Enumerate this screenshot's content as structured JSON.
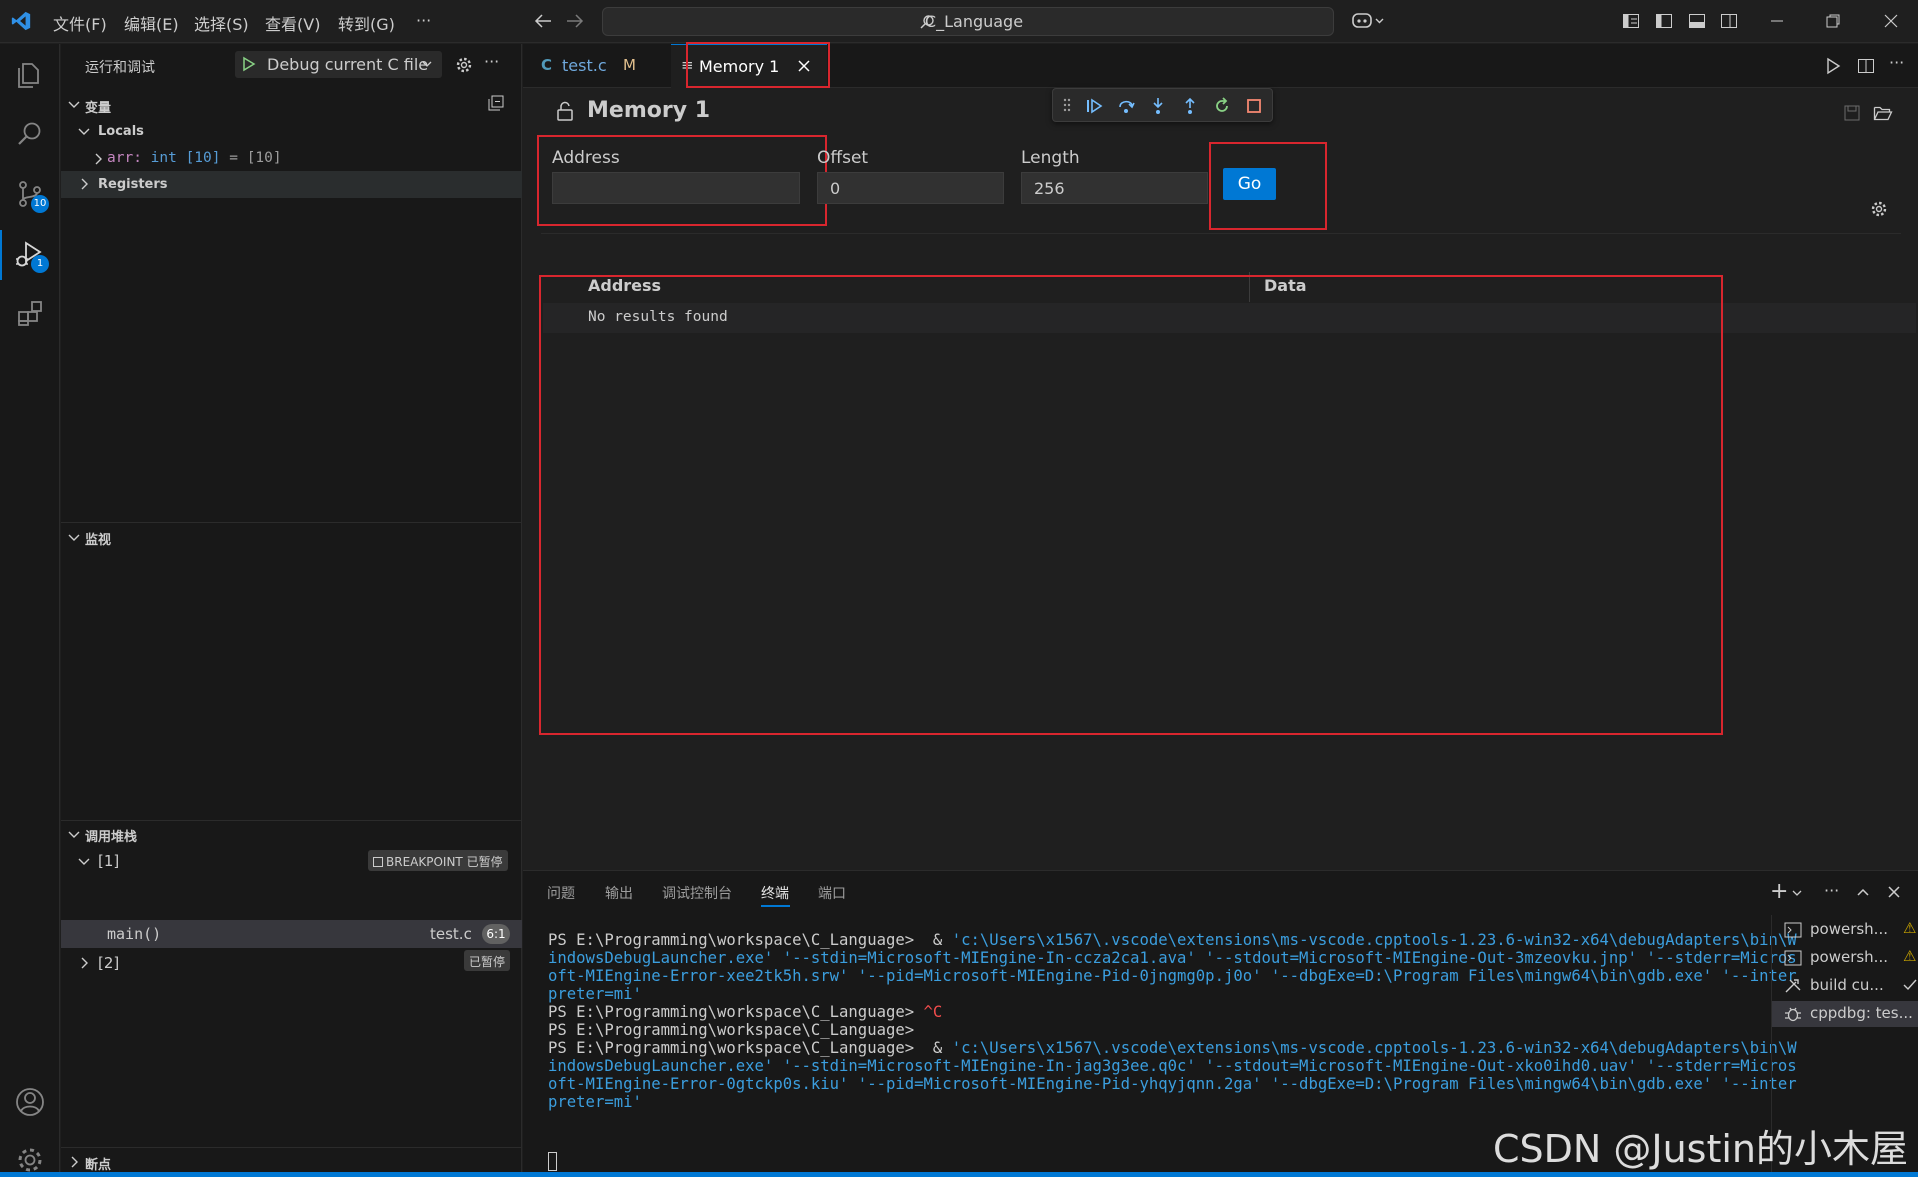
{
  "menu": [
    "文件(F)",
    "编辑(E)",
    "选择(S)",
    "查看(V)",
    "转到(G)",
    "···"
  ],
  "search": {
    "text": "C_Language"
  },
  "activity": {
    "scm_badge": "10",
    "debug_badge": "1"
  },
  "sidebar": {
    "title": "运行和调试",
    "config": "Debug current C file",
    "variables_header": "变量",
    "locals_label": "Locals",
    "arr_name": "arr:",
    "arr_type": "int [10]",
    "arr_eq": "=",
    "arr_value": "[10]",
    "registers_label": "Registers",
    "watch_header": "监视",
    "callstack_header": "调用堆栈",
    "thread1_label": "[1]",
    "thread1_badge": "BREAKPOINT 已暂停",
    "frame_name": "main()",
    "frame_file": "test.c",
    "frame_line": "6:1",
    "thread2_label": "[2]",
    "thread2_badge": "已暂停",
    "breakpoints_header": "断点"
  },
  "tabs": [
    {
      "icon": "C",
      "label": "test.c",
      "badge": "M"
    },
    {
      "icon": "≡",
      "label": "Memory 1"
    }
  ],
  "memory": {
    "title": "Memory 1",
    "address_label": "Address",
    "address_value": "",
    "offset_label": "Offset",
    "offset_value": "0",
    "length_label": "Length",
    "length_value": "256",
    "go_label": "Go",
    "col_address": "Address",
    "col_data": "Data",
    "empty_text": "No results found"
  },
  "panel": {
    "tabs": [
      "问题",
      "输出",
      "调试控制台",
      "终端",
      "端口"
    ],
    "active_tab": "终端",
    "terminals": [
      {
        "label": "powersh...",
        "status": "warning"
      },
      {
        "label": "powersh...",
        "status": "warning"
      },
      {
        "label": "build cu...",
        "status": "check"
      },
      {
        "label": "cppdbg: tes...",
        "status": "active"
      }
    ],
    "lines": [
      {
        "prompt": "PS E:\\Programming\\workspace\\C_Language>  & ",
        "cmd": "'c:\\Users\\x1567\\.vscode\\extensions\\ms-vscode.cpptools-1.23.6-win32-x64\\debugAdapters\\bin\\W"
      },
      {
        "prompt": "",
        "cmd": "indowsDebugLauncher.exe' '--stdin=Microsoft-MIEngine-In-ccza2ca1.ava' '--stdout=Microsoft-MIEngine-Out-3mzeovku.jnp' '--stderr=Micros"
      },
      {
        "prompt": "",
        "cmd": "oft-MIEngine-Error-xee2tk5h.srw' '--pid=Microsoft-MIEngine-Pid-0jngmg0p.j0o' '--dbgExe=D:\\Program Files\\mingw64\\bin\\gdb.exe' '--inter"
      },
      {
        "prompt": "",
        "cmd": "preter=mi'"
      },
      {
        "prompt": "PS E:\\Programming\\workspace\\C_Language> ",
        "ctrl": "^C"
      },
      {
        "prompt": "PS E:\\Programming\\workspace\\C_Language>",
        "cmd": ""
      },
      {
        "prompt": "PS E:\\Programming\\workspace\\C_Language>  & ",
        "cmd": "'c:\\Users\\x1567\\.vscode\\extensions\\ms-vscode.cpptools-1.23.6-win32-x64\\debugAdapters\\bin\\W"
      },
      {
        "prompt": "",
        "cmd": "indowsDebugLauncher.exe' '--stdin=Microsoft-MIEngine-In-jag3g3ee.q0c' '--stdout=Microsoft-MIEngine-Out-xko0ihd0.uav' '--stderr=Micros"
      },
      {
        "prompt": "",
        "cmd": "oft-MIEngine-Error-0gtckp0s.kiu' '--pid=Microsoft-MIEngine-Pid-yhqyjqnn.2ga' '--dbgExe=D:\\Program Files\\mingw64\\bin\\gdb.exe' '--inter"
      },
      {
        "prompt": "",
        "cmd": "preter=mi'"
      }
    ]
  },
  "watermark": "CSDN @Justin的小木屋",
  "colors": {
    "accent": "#0078d4",
    "highlight": "#d8262e",
    "terminal_blue": "#3b9ede"
  }
}
